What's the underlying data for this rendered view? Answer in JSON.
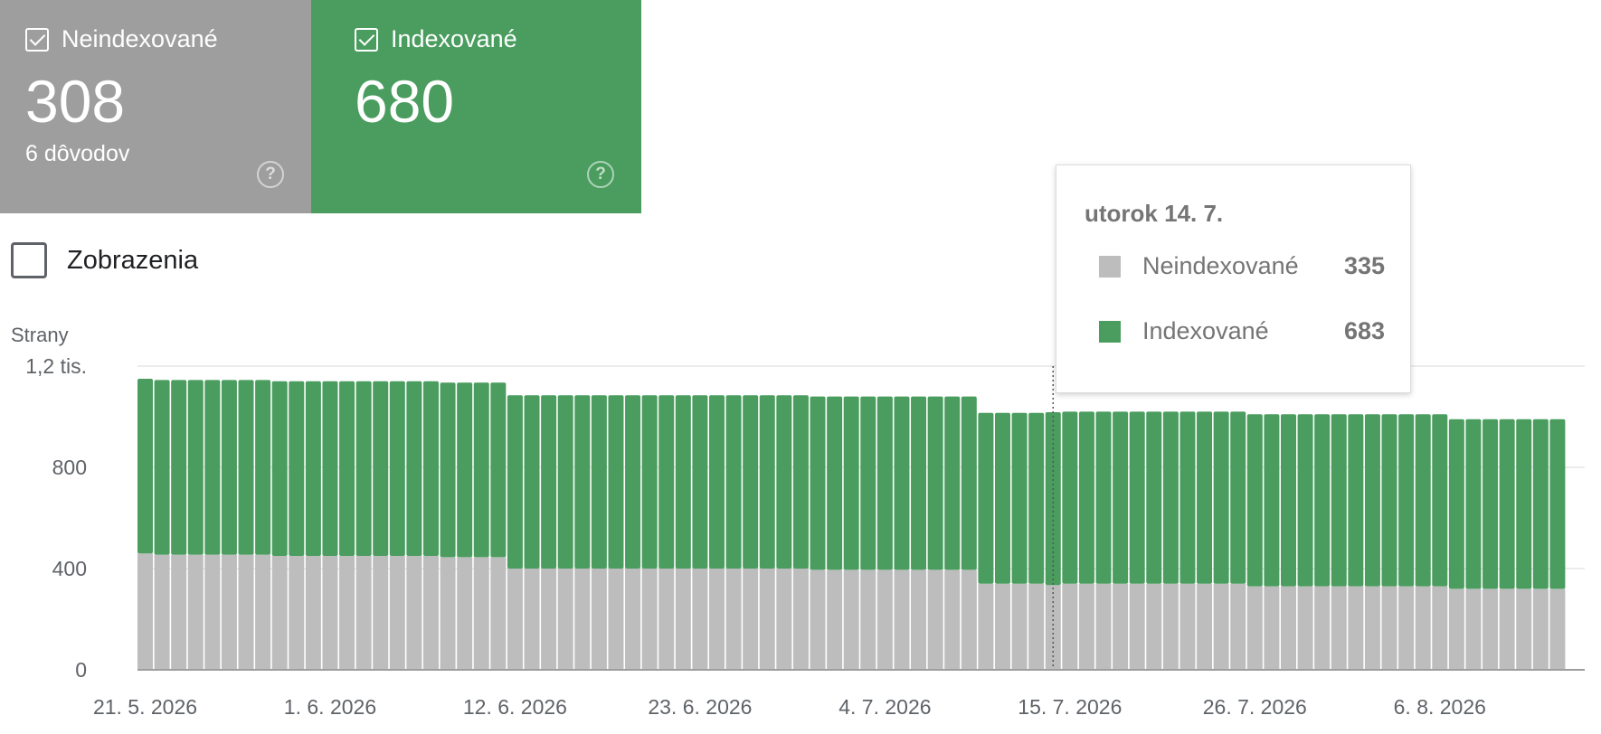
{
  "cards": [
    {
      "label": "Neindexované",
      "value": "308",
      "sub": "6 dôvodov",
      "color": "#9e9e9e"
    },
    {
      "label": "Indexované",
      "value": "680",
      "sub": "",
      "color": "#4a9d5f"
    }
  ],
  "metric_toggle": {
    "label": "Zobrazenia",
    "checked": false
  },
  "tooltip": {
    "date": "utorok 14. 7.",
    "rows": [
      {
        "label": "Neindexované",
        "value": "335",
        "color": "#bdbdbd"
      },
      {
        "label": "Indexované",
        "value": "683",
        "color": "#4a9d5f"
      }
    ]
  },
  "chart_data": {
    "type": "bar",
    "stacked": true,
    "ylabel": "Strany",
    "ylim": [
      0,
      1200
    ],
    "yticks": [
      {
        "value": 0,
        "label": "0"
      },
      {
        "value": 400,
        "label": "400"
      },
      {
        "value": 800,
        "label": "800"
      },
      {
        "value": 1200,
        "label": "1,2 tis."
      }
    ],
    "xtick_labels": [
      {
        "index": 0,
        "label": "21. 5. 2026"
      },
      {
        "index": 11,
        "label": "1. 6. 2026"
      },
      {
        "index": 22,
        "label": "12. 6. 2026"
      },
      {
        "index": 33,
        "label": "23. 6. 2026"
      },
      {
        "index": 44,
        "label": "4. 7. 2026"
      },
      {
        "index": 55,
        "label": "15. 7. 2026"
      },
      {
        "index": 66,
        "label": "26. 7. 2026"
      },
      {
        "index": 77,
        "label": "6. 8. 2026"
      }
    ],
    "categories": [
      "21. 5.",
      "22. 5.",
      "23. 5.",
      "24. 5.",
      "25. 5.",
      "26. 5.",
      "27. 5.",
      "28. 5.",
      "29. 5.",
      "30. 5.",
      "31. 5.",
      "1. 6.",
      "2. 6.",
      "3. 6.",
      "4. 6.",
      "5. 6.",
      "6. 6.",
      "7. 6.",
      "8. 6.",
      "9. 6.",
      "10. 6.",
      "11. 6.",
      "12. 6.",
      "13. 6.",
      "14. 6.",
      "15. 6.",
      "16. 6.",
      "17. 6.",
      "18. 6.",
      "19. 6.",
      "20. 6.",
      "21. 6.",
      "22. 6.",
      "23. 6.",
      "24. 6.",
      "25. 6.",
      "26. 6.",
      "27. 6.",
      "28. 6.",
      "29. 6.",
      "30. 6.",
      "1. 7.",
      "2. 7.",
      "3. 7.",
      "4. 7.",
      "5. 7.",
      "6. 7.",
      "7. 7.",
      "8. 7.",
      "9. 7.",
      "10. 7.",
      "11. 7.",
      "12. 7.",
      "13. 7.",
      "14. 7.",
      "15. 7.",
      "16. 7.",
      "17. 7.",
      "18. 7.",
      "19. 7.",
      "20. 7.",
      "21. 7.",
      "22. 7.",
      "23. 7.",
      "24. 7.",
      "25. 7.",
      "26. 7.",
      "27. 7.",
      "28. 7.",
      "29. 7.",
      "30. 7.",
      "31. 7.",
      "1. 8.",
      "2. 8.",
      "3. 8.",
      "4. 8.",
      "5. 8.",
      "6. 8.",
      "7. 8.",
      "8. 8.",
      "9. 8.",
      "10. 8.",
      "11. 8.",
      "12. 8.",
      "13. 8."
    ],
    "highlight_index": 54,
    "series": [
      {
        "name": "Neindexované",
        "color": "#bdbdbd",
        "values": [
          460,
          455,
          455,
          455,
          455,
          455,
          455,
          455,
          450,
          450,
          450,
          450,
          450,
          450,
          450,
          450,
          450,
          450,
          445,
          445,
          445,
          445,
          400,
          400,
          400,
          400,
          400,
          400,
          400,
          400,
          400,
          400,
          400,
          400,
          400,
          400,
          400,
          400,
          400,
          400,
          395,
          395,
          395,
          395,
          395,
          395,
          395,
          395,
          395,
          395,
          340,
          340,
          340,
          340,
          335,
          340,
          340,
          340,
          340,
          340,
          340,
          340,
          340,
          340,
          340,
          340,
          330,
          330,
          330,
          330,
          330,
          330,
          330,
          330,
          330,
          330,
          330,
          330,
          320,
          320,
          320,
          320,
          320,
          320,
          320,
          320,
          320
        ]
      },
      {
        "name": "Indexované",
        "color": "#4a9d5f",
        "values": [
          690,
          690,
          690,
          690,
          690,
          690,
          690,
          690,
          690,
          690,
          690,
          690,
          690,
          690,
          690,
          690,
          690,
          690,
          690,
          690,
          690,
          690,
          685,
          685,
          685,
          685,
          685,
          685,
          685,
          685,
          685,
          685,
          685,
          685,
          685,
          685,
          685,
          685,
          685,
          685,
          685,
          685,
          685,
          685,
          685,
          685,
          685,
          685,
          685,
          685,
          675,
          675,
          675,
          675,
          683,
          680,
          680,
          680,
          680,
          680,
          680,
          680,
          680,
          680,
          680,
          680,
          680,
          680,
          680,
          680,
          680,
          680,
          680,
          680,
          680,
          680,
          680,
          680,
          670,
          670,
          670,
          670,
          670,
          670,
          670,
          670,
          670
        ]
      }
    ]
  }
}
